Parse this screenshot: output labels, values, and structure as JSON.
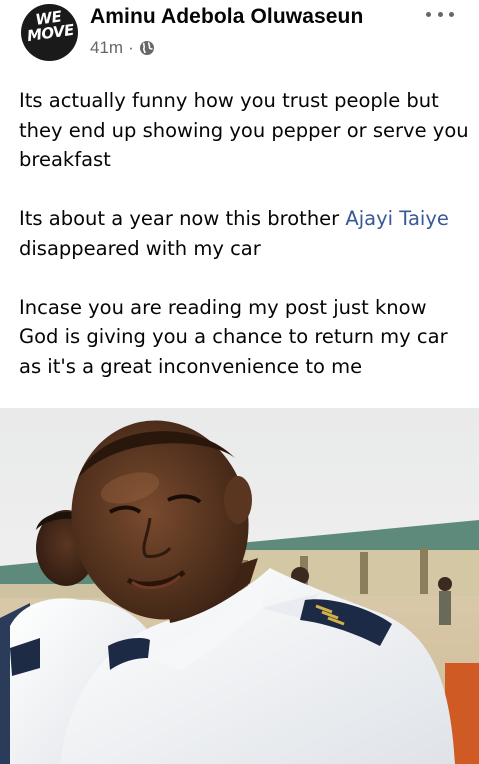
{
  "post": {
    "author": {
      "name": "Aminu Adebola Oluwaseun",
      "avatar_logo": "WE MOVE"
    },
    "timestamp": "41m",
    "separator": "·",
    "privacy_icon": "globe-icon",
    "more_icon": "more-options-icon",
    "text": {
      "paragraph_1": "Its actually funny how you trust people but they end up showing you pepper or serve you breakfast",
      "paragraph_2_before": "Its about a year now this brother ",
      "paragraph_2_mention": "Ajayi Taiye",
      "paragraph_2_after": "  disappeared with my car",
      "paragraph_3": "Incase you are reading my post just know God is giving you a chance to return my car as it's a great inconvenience to me"
    },
    "photo": {
      "subject": "man in white uniform with epaulettes, outdoors"
    },
    "colors": {
      "text": "#050505",
      "meta": "#65676b",
      "mention": "#385898"
    }
  }
}
